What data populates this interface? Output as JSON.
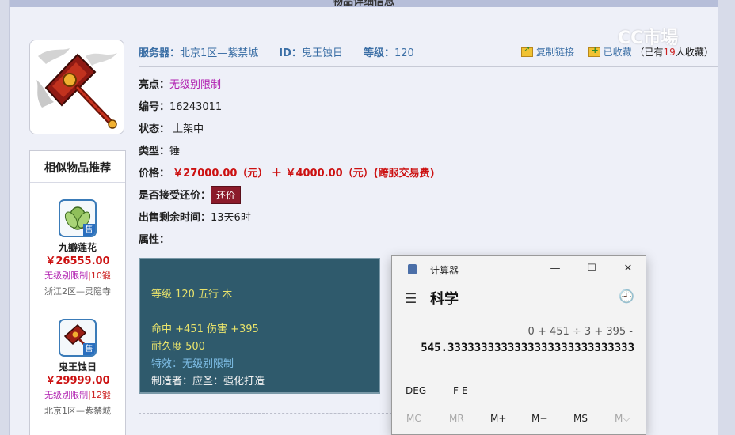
{
  "header": {
    "title": "物品详细信息"
  },
  "watermark": "CC市場",
  "info": {
    "server_label": "服务器：",
    "server_value": "北京1区—紫禁城",
    "id_label": "ID：",
    "id_value": "鬼王蚀日",
    "level_label": "等级：",
    "level_value": "120"
  },
  "actions": {
    "copy_link": "复制链接",
    "collected": "已收藏",
    "collect_prefix": "（已有",
    "collect_count": "19",
    "collect_suffix": "人收藏）"
  },
  "fields": {
    "highlight_label": "亮点：",
    "highlight_value": "无级别限制",
    "number_label": "编号：",
    "number_value": "16243011",
    "status_label": "状态：",
    "status_value": "上架中",
    "type_label": "类型：",
    "type_value": "锤",
    "price_label": "价格：",
    "price_value": "￥27000.00（元） ＋ ￥4000.00（元）(跨服交易费)",
    "bargain_label": "是否接受还价：",
    "bargain_button": "还价",
    "time_label": "出售剩余时间：",
    "time_value": "13天6时",
    "attr_label": "属性："
  },
  "stats": {
    "line1": "等级 120 五行 木",
    "line2": "命中 +451 伤害 +395",
    "line3": "耐久度 500",
    "line4": "特效：无级别限制",
    "line5": "制造者：应圣：强化打造"
  },
  "similar": {
    "title": "相似物品推荐",
    "sale_badge": "售",
    "items": [
      {
        "name": "九瓣莲花",
        "price": "￥26555.00",
        "limit": "无级别限制",
        "forge": "|10锻",
        "server": "浙江2区—灵隐寺"
      },
      {
        "name": "鬼王蚀日",
        "price": "￥29999.00",
        "limit": "无级别限制",
        "forge": "|12锻",
        "server": "北京1区—紫禁城"
      }
    ]
  },
  "calculator": {
    "title": "计算器",
    "mode": "科学",
    "expression": "0 + 451 ÷ 3 + 395 -",
    "result": "545.3333333333333333333333333333",
    "deg": "DEG",
    "fe": "F-E",
    "mem": [
      "MC",
      "MR",
      "M+",
      "M−",
      "MS",
      "M⌵"
    ]
  },
  "colors": {
    "accent_blue": "#3a6ea5",
    "price_red": "#cc1111",
    "magic_purple": "#b01fb0",
    "stats_bg": "#2f5a6c"
  }
}
